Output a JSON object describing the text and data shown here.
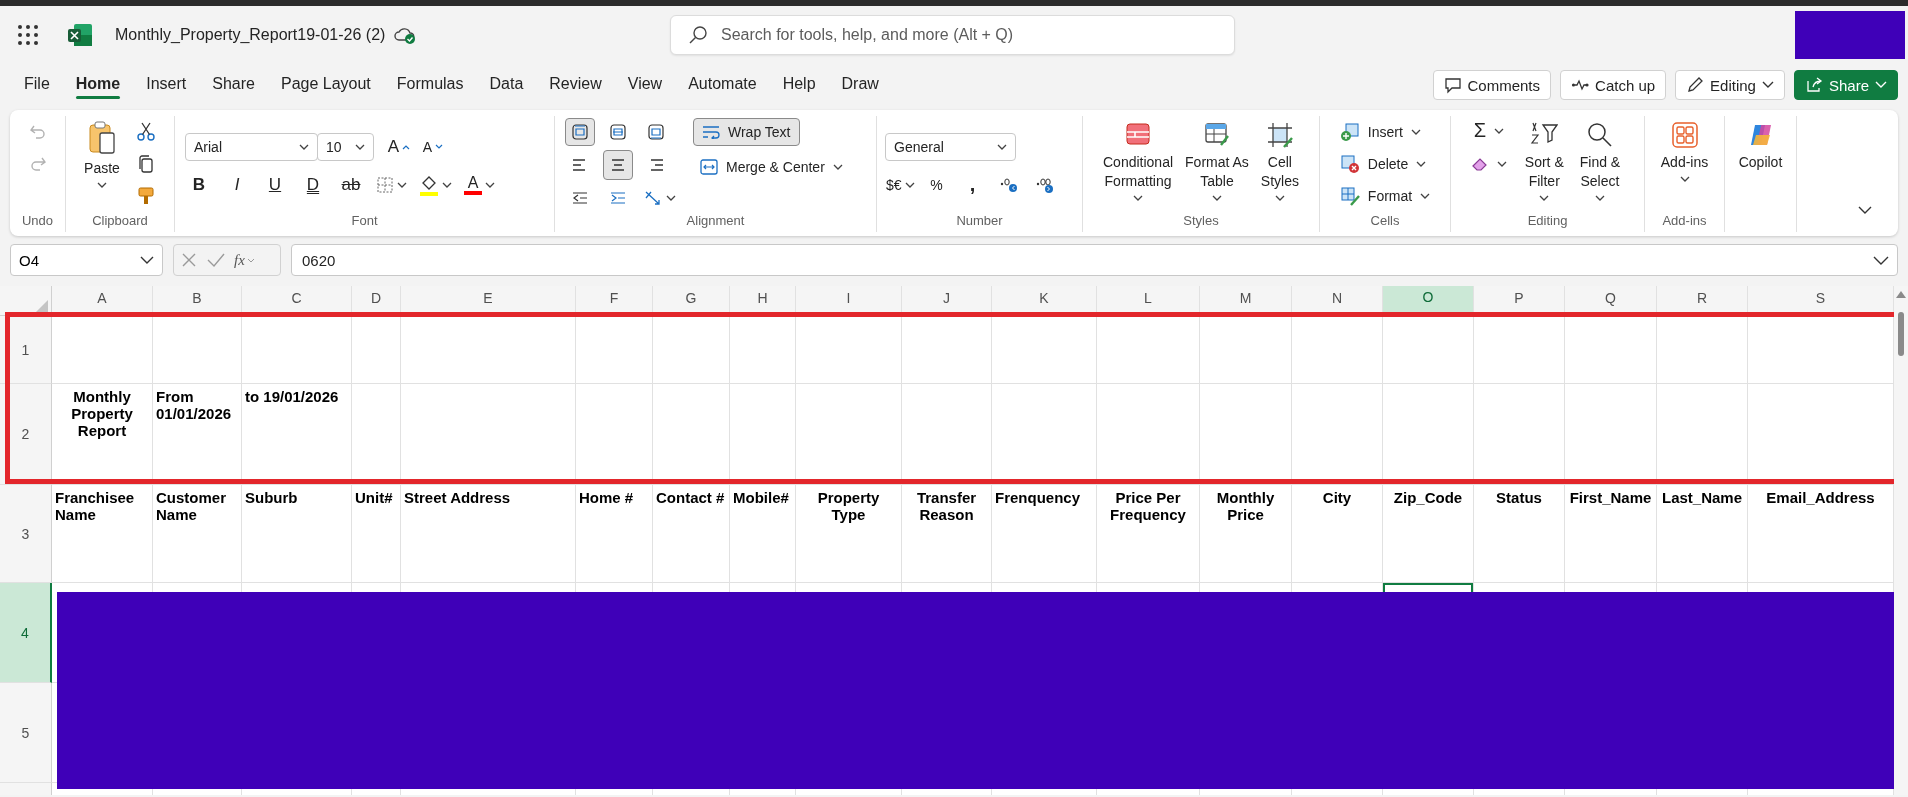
{
  "app_bar": {
    "file_name": "Monthly_Property_Report19-01-26 (2)",
    "saved": true,
    "search": {
      "placeholder": "Search for tools, help, and more (Alt + Q)"
    }
  },
  "menu_tabs": [
    {
      "label": "File",
      "selected": false
    },
    {
      "label": "Home",
      "selected": true
    },
    {
      "label": "Insert",
      "selected": false
    },
    {
      "label": "Share",
      "selected": false
    },
    {
      "label": "Page Layout",
      "selected": false
    },
    {
      "label": "Formulas",
      "selected": false
    },
    {
      "label": "Data",
      "selected": false
    },
    {
      "label": "Review",
      "selected": false
    },
    {
      "label": "View",
      "selected": false
    },
    {
      "label": "Automate",
      "selected": false
    },
    {
      "label": "Help",
      "selected": false
    },
    {
      "label": "Draw",
      "selected": false
    }
  ],
  "actions": [
    {
      "kind": "comments",
      "label": "Comments"
    },
    {
      "kind": "catch_up",
      "label": "Catch up"
    },
    {
      "kind": "editing",
      "label": "Editing"
    },
    {
      "kind": "share",
      "label": "Share"
    }
  ],
  "ribbon": [
    {
      "kind": "undo",
      "label": "Undo",
      "disabled": true
    },
    {
      "kind": "clipboard",
      "label": "Clipboard",
      "paste": "Paste"
    },
    {
      "kind": "font",
      "label": "Font",
      "font_name": "Arial",
      "font_size": "10",
      "grow_glyph": "A",
      "shrink_glyph": "A",
      "styles": [
        {
          "kind": "bold",
          "glyph": "B"
        },
        {
          "kind": "italic",
          "glyph": "I"
        },
        {
          "kind": "underline",
          "glyph": "U"
        },
        {
          "kind": "double_underline",
          "glyph": "D"
        },
        {
          "kind": "strikethrough",
          "glyph": "ab"
        }
      ],
      "font_color_glyph": "A"
    },
    {
      "kind": "alignment",
      "label": "Alignment",
      "vertical": [
        {
          "kind": "top",
          "selected": true
        },
        {
          "kind": "middle",
          "selected": false
        },
        {
          "kind": "bottom",
          "selected": false
        }
      ],
      "horizontal": [
        {
          "kind": "left",
          "selected": false
        },
        {
          "kind": "center",
          "selected": true
        },
        {
          "kind": "right",
          "selected": false
        }
      ],
      "wrap_text": {
        "label": "Wrap Text",
        "selected": true
      },
      "merge": "Merge & Center"
    },
    {
      "kind": "number",
      "label": "Number",
      "format": "General",
      "currency_glyph": "$€",
      "percent_glyph": "%",
      "comma_glyph": ","
    },
    {
      "kind": "styles",
      "label": "Styles",
      "buttons": [
        {
          "kind": "conditional",
          "label": "Conditional\nFormatting"
        },
        {
          "kind": "table",
          "label": "Format As\nTable"
        },
        {
          "kind": "cell_styles",
          "label": "Cell\nStyles"
        }
      ]
    },
    {
      "kind": "cells",
      "label": "Cells",
      "buttons": [
        {
          "kind": "insert",
          "label": "Insert"
        },
        {
          "kind": "delete",
          "label": "Delete"
        },
        {
          "kind": "format",
          "label": "Format"
        }
      ]
    },
    {
      "kind": "editing",
      "label": "Editing",
      "sum_glyph": "Σ",
      "buttons": [
        {
          "kind": "sort",
          "label": "Sort &\nFilter"
        },
        {
          "kind": "find",
          "label": "Find &\nSelect"
        }
      ]
    },
    {
      "kind": "addins",
      "label": "Add-ins",
      "button": "Add-ins"
    },
    {
      "kind": "copilot",
      "button": "Copilot"
    }
  ],
  "formula_bar": {
    "name_box": "O4",
    "insert_function_glyph": "fx",
    "value": "0620"
  },
  "sheet": {
    "columns": [
      {
        "label": "A",
        "selected": false
      },
      {
        "label": "B",
        "selected": false
      },
      {
        "label": "C",
        "selected": false
      },
      {
        "label": "D",
        "selected": false
      },
      {
        "label": "E",
        "selected": false
      },
      {
        "label": "F",
        "selected": false
      },
      {
        "label": "G",
        "selected": false
      },
      {
        "label": "H",
        "selected": false
      },
      {
        "label": "I",
        "selected": false
      },
      {
        "label": "J",
        "selected": false
      },
      {
        "label": "K",
        "selected": false
      },
      {
        "label": "L",
        "selected": false
      },
      {
        "label": "M",
        "selected": false
      },
      {
        "label": "N",
        "selected": false
      },
      {
        "label": "O",
        "selected": true
      },
      {
        "label": "P",
        "selected": false
      },
      {
        "label": "Q",
        "selected": false
      },
      {
        "label": "R",
        "selected": false
      },
      {
        "label": "S",
        "selected": false
      }
    ],
    "rows": [
      {
        "number": "1",
        "selected": false
      },
      {
        "number": "2",
        "selected": false,
        "kind": "title",
        "cells": [
          "Monthly Property Report",
          "From 01/01/2026",
          "to 19/01/2026"
        ]
      },
      {
        "number": "3",
        "selected": false,
        "kind": "header",
        "cells": [
          "Franchisee Name",
          "Customer Name",
          "Suburb",
          "Unit#",
          "Street Address",
          "Home #",
          "Contact #",
          "Mobile#",
          "Property Type",
          "Transfer Reason",
          "Frenquency",
          "Price Per Frequency",
          "Monthly Price",
          "City",
          "Zip_Code",
          "Status",
          "First_Name",
          "Last_Name",
          "Email_Address"
        ]
      },
      {
        "number": "4",
        "selected": true
      },
      {
        "number": "5",
        "selected": false
      }
    ]
  }
}
